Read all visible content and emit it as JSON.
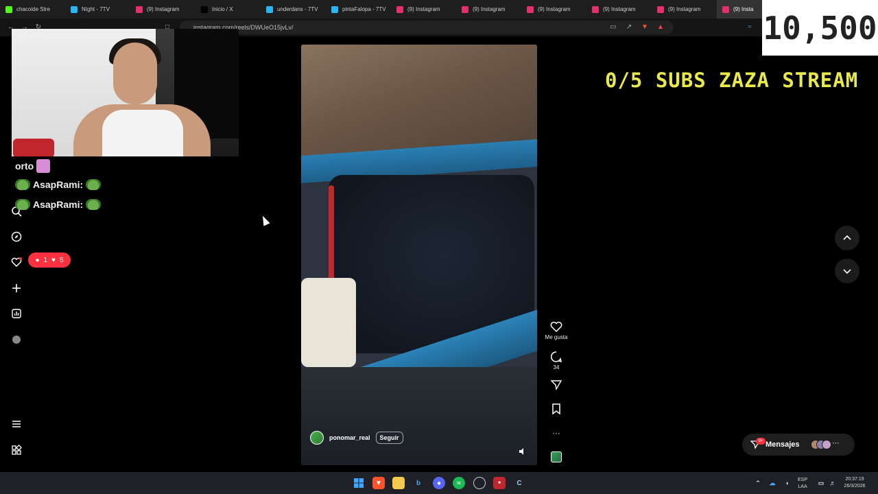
{
  "tabs": [
    {
      "label": "chacoide Stre",
      "icon": "kick-icon",
      "color": "#53fc18"
    },
    {
      "label": "NIght - 7TV",
      "icon": "7tv-icon",
      "color": "#29b6f6"
    },
    {
      "label": "(9) Instagram",
      "icon": "instagram-icon",
      "color": "#e1306c"
    },
    {
      "label": "Inicio / X",
      "icon": "x-icon",
      "color": "#000000"
    },
    {
      "label": "underdans - 7TV",
      "icon": "7tv-icon",
      "color": "#29b6f6"
    },
    {
      "label": "pintaFalopa - 7TV",
      "icon": "7tv-icon",
      "color": "#29b6f6"
    },
    {
      "label": "(9) Instagram",
      "icon": "instagram-icon",
      "color": "#e1306c"
    },
    {
      "label": "(9) Instagram",
      "icon": "instagram-icon",
      "color": "#e1306c"
    },
    {
      "label": "(9) Instagram",
      "icon": "instagram-icon",
      "color": "#e1306c"
    },
    {
      "label": "(9) Instagram",
      "icon": "instagram-icon",
      "color": "#e1306c"
    },
    {
      "label": "(9) Instagram",
      "icon": "instagram-icon",
      "color": "#e1306c"
    },
    {
      "label": "(9) Insta",
      "icon": "instagram-icon",
      "color": "#e1306c",
      "active": true
    }
  ],
  "address_bar": {
    "url": "instagram.com/reels/DWUeO15jvLv/"
  },
  "overlay": {
    "sub_count": "10,500",
    "goal_text": "0/5 SUBS ZAZA STREAM"
  },
  "chat": {
    "partial_line": "orto",
    "lines": [
      {
        "user": "AsapRami:",
        "emote": "frog-emote"
      },
      {
        "user": "AsapRami:",
        "emote": "frog-emote"
      }
    ]
  },
  "notifications": {
    "comments": "1",
    "likes": "5"
  },
  "reel": {
    "username": "ponomar_real",
    "follow_label": "Seguir",
    "like_label": "Me gusta",
    "comment_count": "34"
  },
  "messages": {
    "label": "Mensajes",
    "badge": "9+"
  },
  "taskbar": {
    "lang_top": "ESP",
    "lang_bottom": "LAA",
    "time": "20:37:19",
    "date": "26/3/2026"
  },
  "colors": {
    "accent": "#ff3040",
    "overlay_yellow": "#e8e94a",
    "background": "#000000"
  }
}
